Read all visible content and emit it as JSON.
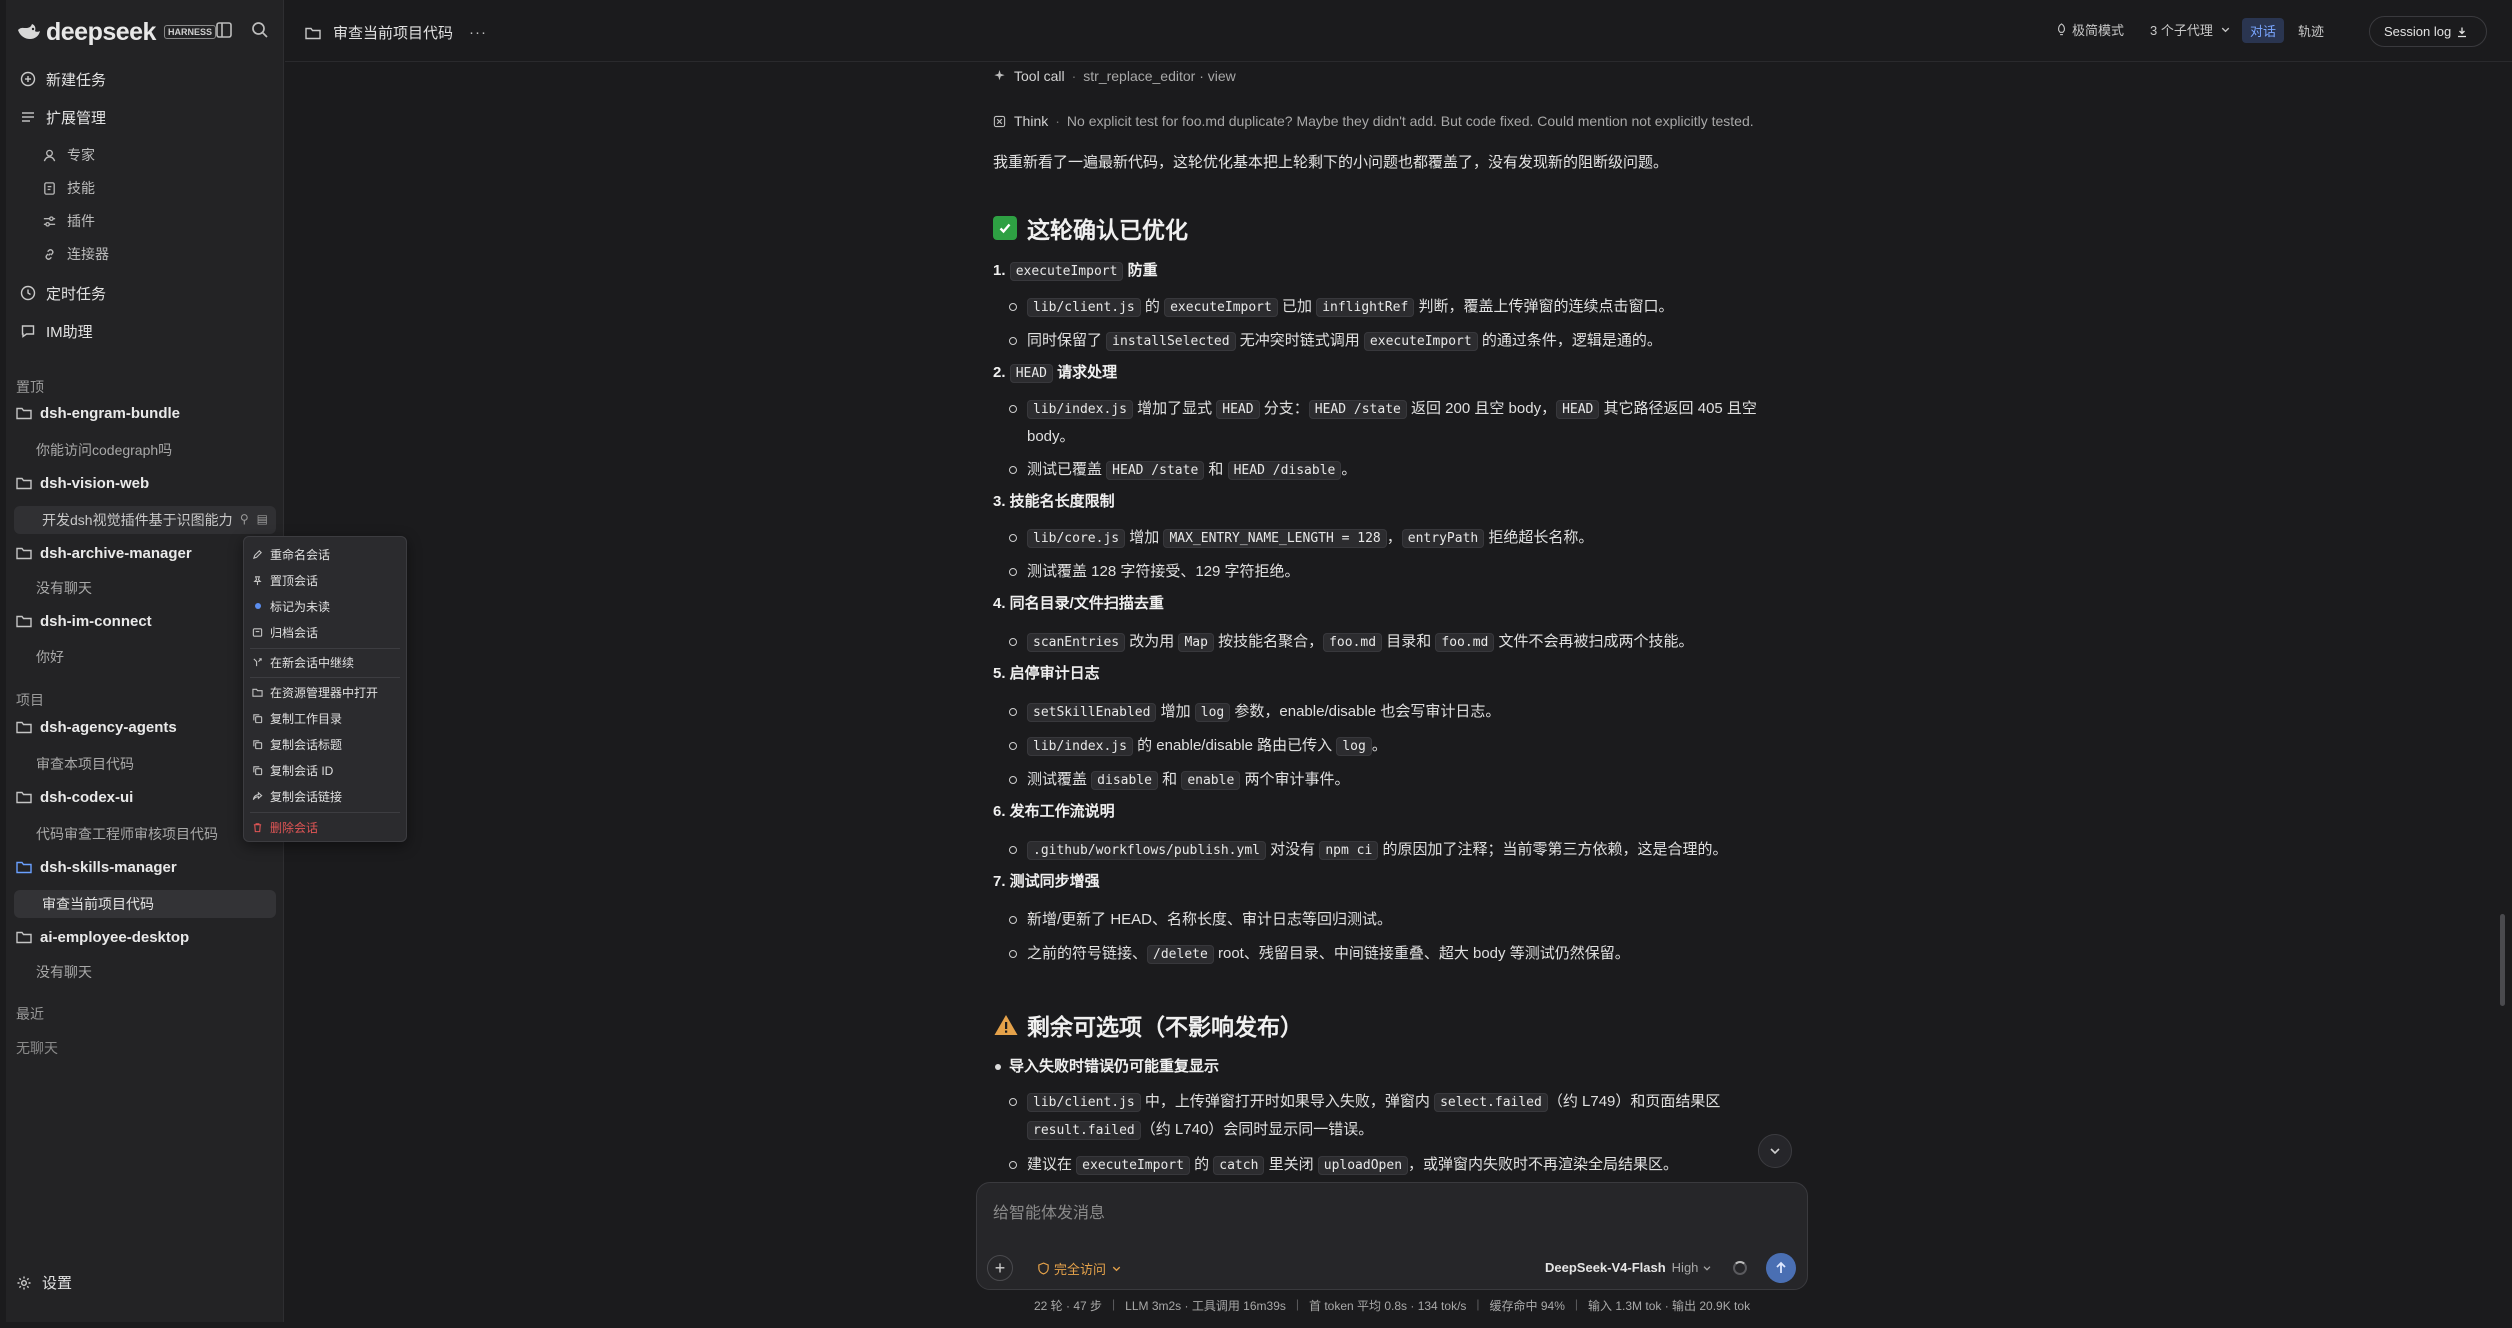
{
  "brand": {
    "name": "deepseek",
    "badge": "HARNESS"
  },
  "nav": {
    "new_task": "新建任务",
    "ext_mgmt": "扩展管理",
    "experts": "专家",
    "skills": "技能",
    "plugins": "插件",
    "connectors": "连接器",
    "scheduled": "定时任务",
    "im": "IM助理"
  },
  "sidebar": {
    "pinned_label": "置顶",
    "projects_label": "项目",
    "recent_label": "最近",
    "recent_empty": "无聊天",
    "pinned": [
      {
        "project": "dsh-engram-bundle",
        "conv": "你能访问codegraph吗"
      },
      {
        "project": "dsh-vision-web",
        "conv": "开发dsh视觉插件基于识图能力"
      },
      {
        "project": "dsh-archive-manager",
        "conv": "没有聊天"
      },
      {
        "project": "dsh-im-connect",
        "conv": "你好"
      }
    ],
    "projects": [
      {
        "project": "dsh-agency-agents",
        "conv": "审查本项目代码"
      },
      {
        "project": "dsh-codex-ui",
        "conv": "代码审查工程师审核项目代码"
      },
      {
        "project": "dsh-skills-manager",
        "conv": "审查当前项目代码"
      },
      {
        "project": "ai-employee-desktop",
        "conv": "没有聊天"
      }
    ],
    "settings": "设置"
  },
  "context_menu": {
    "rename": "重命名会话",
    "pin": "置顶会话",
    "mark_unread": "标记为未读",
    "archive": "归档会话",
    "continue_new": "在新会话中继续",
    "open_explorer": "在资源管理器中打开",
    "copy_workdir": "复制工作目录",
    "copy_title": "复制会话标题",
    "copy_id": "复制会话 ID",
    "copy_link": "复制会话链接",
    "delete": "删除会话"
  },
  "header": {
    "title": "审查当前项目代码",
    "more": "···",
    "speed_mode": "极简模式",
    "subagents": "3 个子代理",
    "tab_dialog": "对话",
    "tab_trace": "轨迹",
    "session_log": "Session log"
  },
  "content": {
    "tool_call_k": "Tool call",
    "tool_call_v": "str_replace_editor · view",
    "think_k": "Think",
    "think_v": "No explicit test for foo.md duplicate? Maybe they didn't add. But code fixed. Could mention not explicitly tested.",
    "intro": "我重新看了一遍最新代码，这轮优化基本把上轮剩下的小问题也都覆盖了，没有发现新的阻断级问题。",
    "h_confirmed": "这轮确认已优化",
    "h_remaining": "剩余可选项（不影响发布）"
  },
  "composer": {
    "placeholder": "给智能体发消息",
    "access": "完全访问",
    "model": "DeepSeek-V4-Flash",
    "level": "High"
  },
  "status": {
    "turns": "22 轮 · 47 步",
    "llm": "LLM 3m2s · 工具调用 16m39s",
    "token": "首 token 平均 0.8s · 134 tok/s",
    "cache": "缓存命中 94%",
    "io": "输入 1.3M tok · 输出 20.9K tok"
  },
  "colors": {
    "accent": "#5b8def",
    "danger": "#e05555",
    "warning": "#e5a24a",
    "success": "#2ea043"
  }
}
